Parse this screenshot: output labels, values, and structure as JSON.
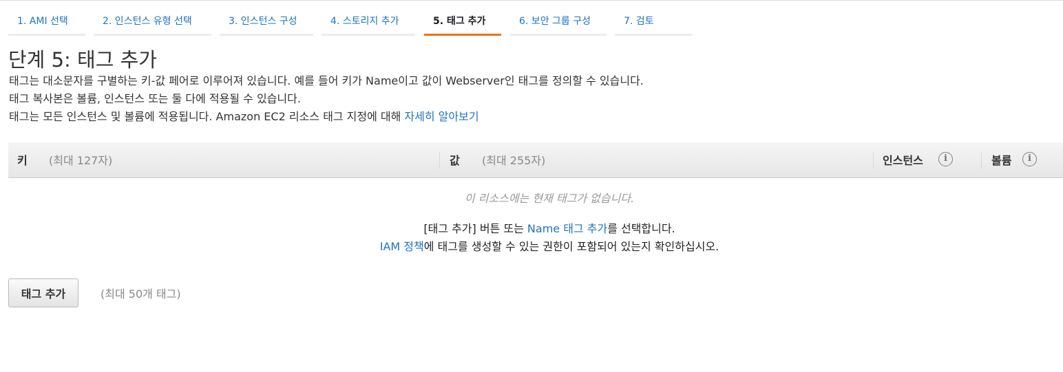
{
  "wizard": {
    "steps": [
      {
        "label": "1. AMI 선택"
      },
      {
        "label": "2. 인스턴스 유형 선택"
      },
      {
        "label": "3. 인스턴스 구성"
      },
      {
        "label": "4. 스토리지 추가"
      },
      {
        "label": "5. 태그 추가",
        "active": true
      },
      {
        "label": "6. 보안 그룹 구성"
      },
      {
        "label": "7. 검토"
      }
    ]
  },
  "page": {
    "title": "단계 5: 태그 추가",
    "description": [
      "태그는 대소문자를 구별하는 키-값 페어로 이루어져 있습니다. 예를 들어 키가 Name이고 값이 Webserver인 태그를 정의할 수 있습니다.",
      "태그 복사본은 볼륨, 인스턴스 또는 둘 다에 적용될 수 있습니다."
    ],
    "description_line3": {
      "text": "태그는 모든 인스턴스 및 볼륨에 적용됩니다. Amazon EC2 리소스 태그 지정에 대해",
      "link": "자세히 알아보기"
    }
  },
  "table": {
    "columns": {
      "key": {
        "label": "키",
        "hint": "(최대 127자)"
      },
      "value": {
        "label": "값",
        "hint": "(최대 255자)"
      },
      "instances": {
        "label": "인스턴스"
      },
      "volumes": {
        "label": "볼륨"
      }
    },
    "info_glyph": "i",
    "empty_message": "이 리소스에는 현재 태그가 없습니다.",
    "hint_line1": {
      "before": "[태그 추가] 버튼 또는",
      "link": "Name 태그 추가",
      "after": "를 선택합니다."
    },
    "hint_line2": {
      "link": "IAM 정책",
      "after": "에 태그를 생성할 수 있는 권한이 포함되어 있는지 확인하십시오."
    }
  },
  "actions": {
    "add_tag_label": "태그 추가",
    "max_tags_note": "(최대 50개 태그)"
  },
  "colors": {
    "link": "#1e73be",
    "active_tab_underline": "#ec7211",
    "tab_underline": "#eaeded"
  }
}
